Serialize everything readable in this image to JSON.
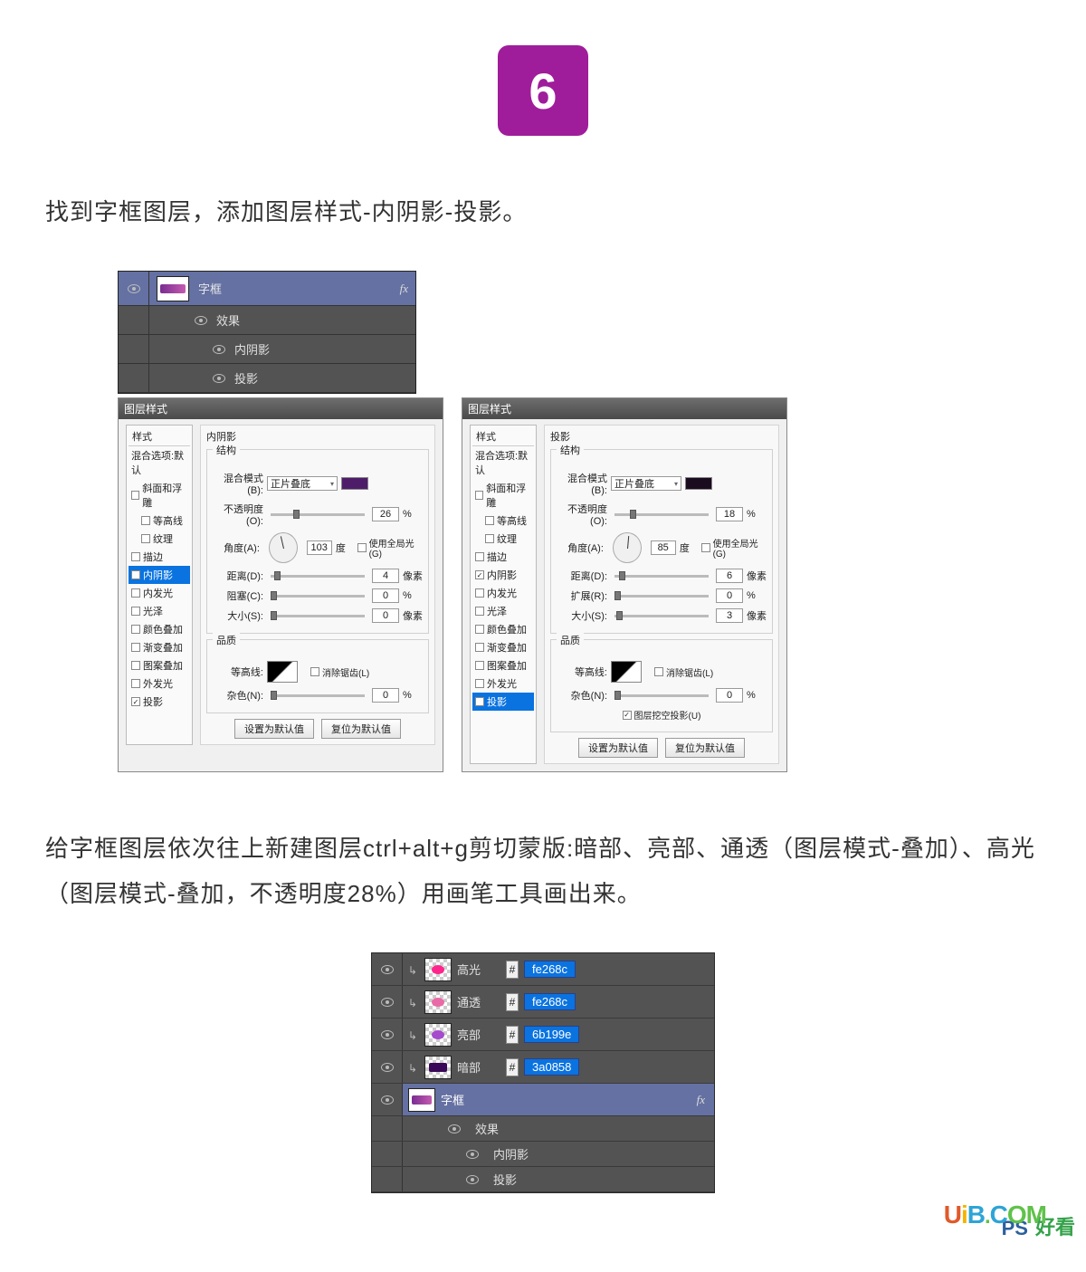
{
  "step_number": "6",
  "desc1": "找到字框图层，添加图层样式-内阴影-投影。",
  "desc2": "给字框图层依次往上新建图层ctrl+alt+g剪切蒙版:暗部、亮部、通透（图层模式-叠加）、高光（图层模式-叠加，不透明度28%）用画笔工具画出来。",
  "layers_small": {
    "main": "字框",
    "fx_label": "fx",
    "effects_label": "效果",
    "sub1": "内阴影",
    "sub2": "投影"
  },
  "dialog_inner_shadow": {
    "window_title": "图层样式",
    "left_header": "样式",
    "items": {
      "blend_default": "混合选项:默认",
      "bevel": "斜面和浮雕",
      "contour": "等高线",
      "texture": "纹理",
      "stroke": "描边",
      "inner_shadow": "内阴影",
      "inner_glow": "内发光",
      "satin": "光泽",
      "color_overlay": "颜色叠加",
      "grad_overlay": "渐变叠加",
      "pattern_overlay": "图案叠加",
      "outer_glow": "外发光",
      "drop_shadow": "投影"
    },
    "section_label": "内阴影",
    "struct_label": "结构",
    "blend_mode_label": "混合模式(B):",
    "blend_mode_value": "正片叠底",
    "opacity_label": "不透明度(O):",
    "opacity_value": "26",
    "angle_label": "角度(A):",
    "angle_value": "103",
    "global_light": "使用全局光(G)",
    "distance_label": "距离(D):",
    "distance_value": "4",
    "distance_unit": "像素",
    "choke_label": "阻塞(C):",
    "choke_value": "0",
    "size_label": "大小(S):",
    "size_value": "0",
    "size_unit": "像素",
    "quality_label": "品质",
    "contour_label": "等高线:",
    "antialias": "消除锯齿(L)",
    "noise_label": "杂色(N):",
    "noise_value": "0",
    "btn_default": "设置为默认值",
    "btn_reset": "复位为默认值",
    "percent": "%",
    "degree": "度",
    "color_swatch": "#4e1d6a"
  },
  "dialog_drop_shadow": {
    "window_title": "图层样式",
    "left_header": "样式",
    "items": {
      "blend_default": "混合选项:默认",
      "bevel": "斜面和浮雕",
      "contour": "等高线",
      "texture": "纹理",
      "stroke": "描边",
      "inner_shadow": "内阴影",
      "inner_glow": "内发光",
      "satin": "光泽",
      "color_overlay": "颜色叠加",
      "grad_overlay": "渐变叠加",
      "pattern_overlay": "图案叠加",
      "outer_glow": "外发光",
      "drop_shadow": "投影"
    },
    "section_label": "投影",
    "struct_label": "结构",
    "blend_mode_label": "混合模式(B):",
    "blend_mode_value": "正片叠底",
    "opacity_label": "不透明度(O):",
    "opacity_value": "18",
    "angle_label": "角度(A):",
    "angle_value": "85",
    "global_light": "使用全局光(G)",
    "distance_label": "距离(D):",
    "distance_value": "6",
    "distance_unit": "像素",
    "spread_label": "扩展(R):",
    "spread_value": "0",
    "size_label": "大小(S):",
    "size_value": "3",
    "size_unit": "像素",
    "quality_label": "品质",
    "contour_label": "等高线:",
    "antialias": "消除锯齿(L)",
    "noise_label": "杂色(N):",
    "noise_value": "0",
    "knockout": "图层挖空投影(U)",
    "btn_default": "设置为默认值",
    "btn_reset": "复位为默认值",
    "percent": "%",
    "degree": "度",
    "color_swatch": "#1a0b1f"
  },
  "layers_color": {
    "rows": [
      {
        "name": "高光",
        "hex": "fe268c",
        "spot": "#fe268c"
      },
      {
        "name": "通透",
        "hex": "fe268c",
        "spot": "#e96aa6"
      },
      {
        "name": "亮部",
        "hex": "6b199e",
        "spot": "#a64bcd"
      },
      {
        "name": "暗部",
        "hex": "3a0858",
        "spot": "#3a0858"
      }
    ],
    "hash": "#",
    "base_name": "字框",
    "fx_label": "fx",
    "effects_label": "效果",
    "sub1": "内阴影",
    "sub2": "投影"
  },
  "watermark": {
    "text": "UiB.COM",
    "ps": "PS",
    "ch": "好看"
  }
}
